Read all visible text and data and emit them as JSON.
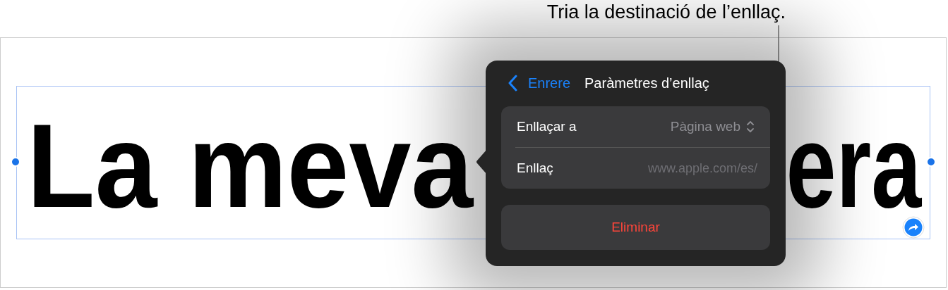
{
  "callout": {
    "text": "Tria la destinació de l’enllaç."
  },
  "canvas": {
    "text_fragments": [
      "La meva",
      "era"
    ],
    "selected": true
  },
  "popover": {
    "back_button": "Enrere",
    "title": "Paràmetres d’enllaç",
    "rows": [
      {
        "kind": "picker",
        "label": "Enllaçar a",
        "value": "Pàgina web"
      },
      {
        "kind": "field",
        "label": "Enllaç",
        "placeholder": "www.apple.com/es/"
      }
    ],
    "delete_button": "Eliminar"
  }
}
